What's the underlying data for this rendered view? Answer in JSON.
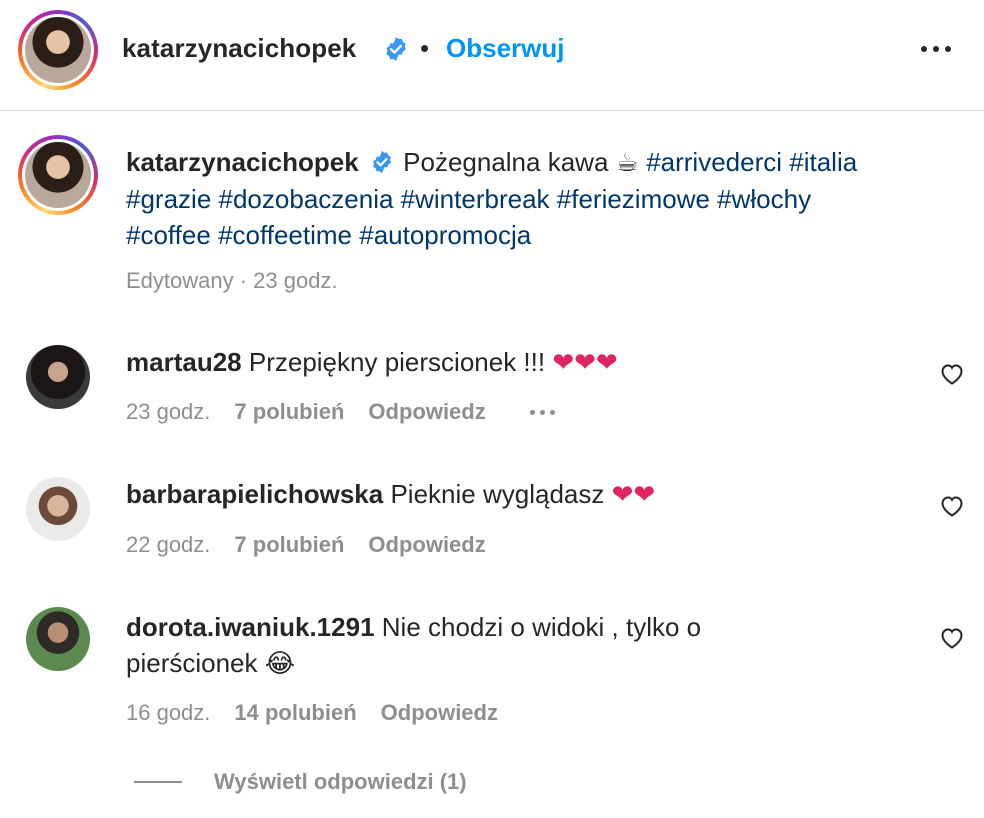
{
  "header": {
    "username": "katarzynacichopek",
    "separator": "•",
    "follow_label": "Obserwuj"
  },
  "caption": {
    "username": "katarzynacichopek",
    "text": "Pożegnalna kawa",
    "emoji": "☕",
    "hashtags": [
      "#arrivederci",
      "#italia",
      "#grazie",
      "#dozobaczenia",
      "#winterbreak",
      "#feriezimowe",
      "#włochy",
      "#coffee",
      "#coffeetime",
      "#autopromocja"
    ],
    "meta": "Edytowany · 23 godz."
  },
  "comments": [
    {
      "username": "martau28",
      "text": "Przepiękny pierscionek !!!",
      "emoji": "❤❤❤",
      "time": "23 godz.",
      "likes": "7 polubień",
      "reply": "Odpowiedz"
    },
    {
      "username": "barbarapielichowska",
      "text": "Pieknie wyglądasz",
      "emoji": "❤❤",
      "time": "22 godz.",
      "likes": "7 polubień",
      "reply": "Odpowiedz"
    },
    {
      "username": "dorota.iwaniuk.1291",
      "text": "Nie chodzi o widoki , tylko o pierścionek",
      "emoji": "😂",
      "time": "16 godz.",
      "likes": "14 polubień",
      "reply": "Odpowiedz"
    }
  ],
  "view_replies_label": "Wyświetl odpowiedzi (1)",
  "colors": {
    "follow": "#0095f6",
    "hashtag": "#00376b",
    "meta": "#8e8e8e",
    "verified": "#3897f0"
  },
  "icons": {
    "verified": "verified-badge-icon",
    "more": "more-options-icon",
    "heart": "heart-outline-icon"
  }
}
